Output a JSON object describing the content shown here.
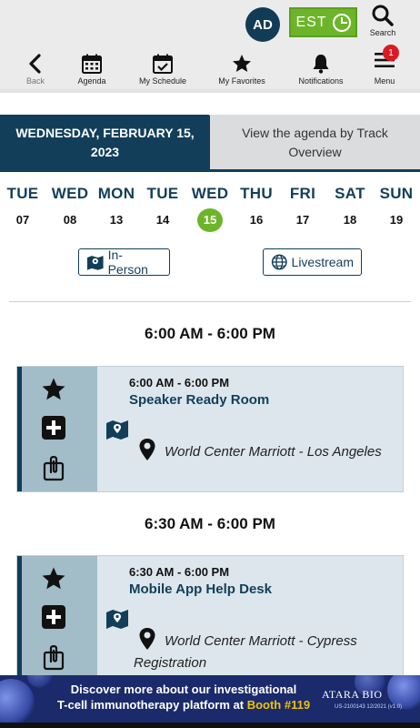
{
  "header": {
    "avatar_initials": "AD",
    "timezone_label": "EST",
    "search_label": "Search",
    "nav": [
      {
        "label": "Back",
        "icon": "back-arrow-icon"
      },
      {
        "label": "Agenda",
        "icon": "calendar-icon"
      },
      {
        "label": "My Schedule",
        "icon": "calendar-check-icon"
      },
      {
        "label": "My Favorites",
        "icon": "star-icon"
      },
      {
        "label": "Notifications",
        "icon": "bell-icon"
      },
      {
        "label": "Menu",
        "icon": "hamburger-icon",
        "badge": "1"
      }
    ]
  },
  "tabs": {
    "active": "WEDNESDAY, FEBRUARY 15, 2023",
    "inactive": "View the agenda by Track Overview"
  },
  "dates": [
    {
      "dow": "TUE",
      "num": "07"
    },
    {
      "dow": "WED",
      "num": "08"
    },
    {
      "dow": "MON",
      "num": "13"
    },
    {
      "dow": "TUE",
      "num": "14"
    },
    {
      "dow": "WED",
      "num": "15",
      "selected": true
    },
    {
      "dow": "THU",
      "num": "16"
    },
    {
      "dow": "FRI",
      "num": "17"
    },
    {
      "dow": "SAT",
      "num": "18"
    },
    {
      "dow": "SUN",
      "num": "19"
    }
  ],
  "filters": {
    "in_person": "In-Person",
    "livestream": "Livestream"
  },
  "sessions": [
    {
      "group_time": "6:00 AM - 6:00 PM",
      "time": "6:00 AM - 6:00 PM",
      "title": "Speaker Ready Room",
      "location": "World Center Marriott - Los Angeles"
    },
    {
      "group_time": "6:30 AM - 6:00 PM",
      "time": "6:30 AM - 6:00 PM",
      "title": "Mobile App Help Desk",
      "location": "World Center Marriott - Cypress Registration"
    }
  ],
  "banner": {
    "line1": "Discover more about our investigational",
    "line2_prefix": "T-cell immunotherapy platform at ",
    "line2_booth": "Booth #119",
    "brand": "ATARA BIO",
    "fine": "US-2100143 12/2021 (v1.0)"
  },
  "colors": {
    "primary": "#123e5a",
    "accent_green": "#6cb52a",
    "badge_red": "#d91c24",
    "card_bg": "#dce6ec",
    "icon_col_bg": "#a2bcc8",
    "banner_bg": "#1a2a6b",
    "booth_yellow": "#f2c200"
  }
}
